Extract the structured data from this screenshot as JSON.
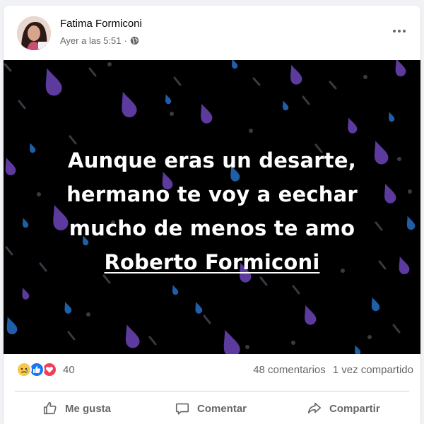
{
  "post": {
    "author": "Fatima Formiconi",
    "time": "Ayer a las 5:51",
    "privacy_icon": "globe-icon",
    "more_icon": "more-options-icon",
    "image_text": {
      "line1": "Aunque eras un desarte,",
      "line2": "hermano te voy a eechar",
      "line3": "mucho de menos te amo",
      "mention": "Roberto Formiconi"
    }
  },
  "stats": {
    "reaction_icons": [
      "sad-reaction-icon",
      "like-reaction-icon",
      "love-reaction-icon"
    ],
    "reaction_count": "40",
    "comments": "48 comentarios",
    "shares": "1 vez compartido"
  },
  "actions": {
    "like": "Me gusta",
    "comment": "Comentar",
    "share": "Compartir"
  },
  "colors": {
    "background": "#f0f2f5",
    "card": "#ffffff",
    "muted_text": "#65676b",
    "like_blue": "#1877f2",
    "love_red": "#f33e58",
    "sad_yellow": "#f7c84b",
    "rain_purple": "#5c3a9e",
    "rain_blue": "#1e5fa8"
  }
}
